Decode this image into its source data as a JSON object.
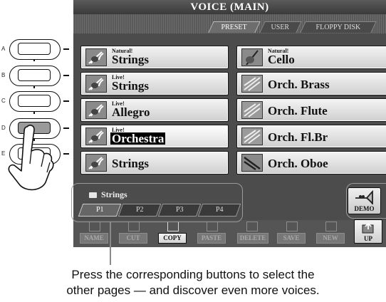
{
  "screen": {
    "title": "VOICE (MAIN)",
    "tabs": [
      {
        "label": "PRESET",
        "active": true
      },
      {
        "label": "USER",
        "active": false
      },
      {
        "label": "FLOPPY DISK",
        "active": false
      }
    ]
  },
  "left_buttons": [
    "A",
    "B",
    "C",
    "D",
    "E"
  ],
  "voices_left": [
    {
      "sub": "Natural!",
      "name": "Strings",
      "selected": false
    },
    {
      "sub": "Live!",
      "name": "Strings",
      "selected": false
    },
    {
      "sub": "Live!",
      "name": "Allegro",
      "selected": false
    },
    {
      "sub": "Live!",
      "name": "Orchestra",
      "selected": true
    },
    {
      "sub": "",
      "name": "Strings",
      "selected": false
    }
  ],
  "voices_right": [
    {
      "sub": "Natural!",
      "name": "Cello"
    },
    {
      "sub": "",
      "name": "Orch. Brass"
    },
    {
      "sub": "",
      "name": "Orch. Flute"
    },
    {
      "sub": "",
      "name": "Orch. Fl.Br"
    },
    {
      "sub": "",
      "name": "Orch. Oboe"
    }
  ],
  "bank": {
    "name": "Strings"
  },
  "pages": [
    {
      "label": "P1",
      "active": true
    },
    {
      "label": "P2",
      "active": false
    },
    {
      "label": "P3",
      "active": false
    },
    {
      "label": "P4",
      "active": false
    }
  ],
  "demo_label": "DEMO",
  "functions": [
    {
      "label": "NAME",
      "enabled": false
    },
    {
      "label": "CUT",
      "enabled": false
    },
    {
      "label": "COPY",
      "enabled": true
    },
    {
      "label": "PASTE",
      "enabled": false
    },
    {
      "label": "DELETE",
      "enabled": false
    },
    {
      "label": "SAVE",
      "enabled": false
    },
    {
      "label": "NEW",
      "enabled": false
    }
  ],
  "up_label": "UP",
  "caption": {
    "line1": "Press the corresponding buttons to select the",
    "line2": "other pages — and discover even more voices."
  }
}
